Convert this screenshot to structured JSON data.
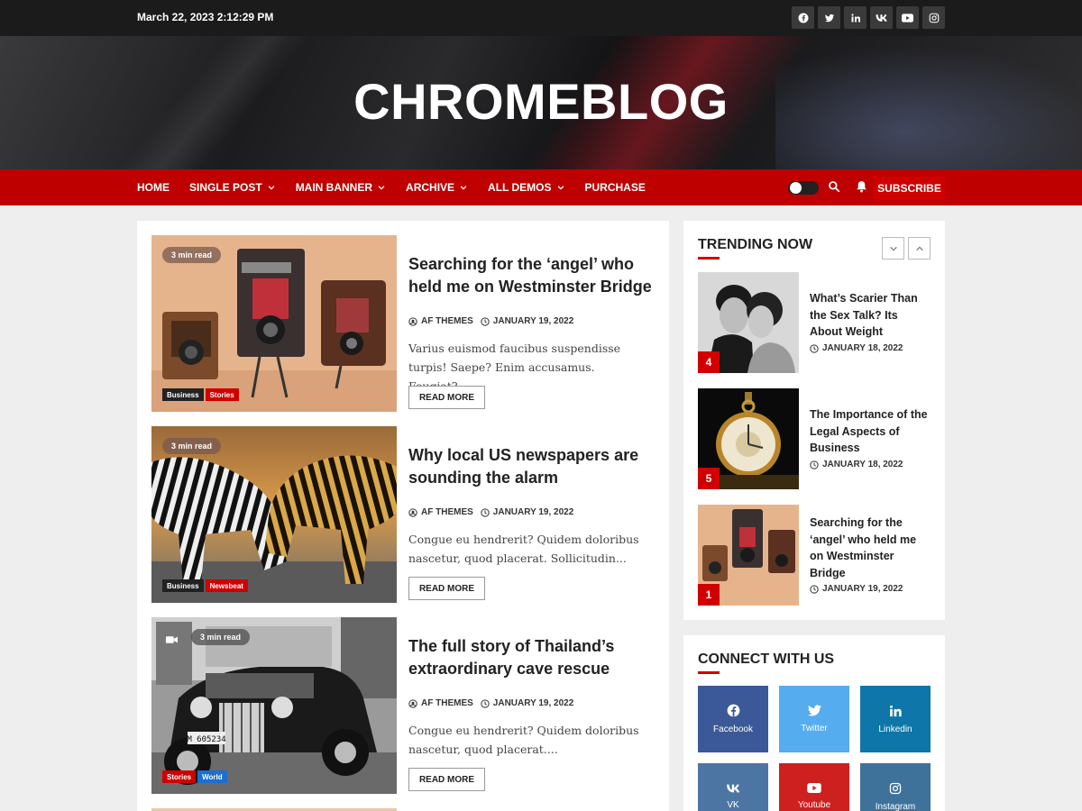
{
  "topbar": {
    "datetime": "March 22, 2023 2:12:29 PM",
    "socials": [
      "facebook-icon",
      "twitter-icon",
      "linkedin-icon",
      "vk-icon",
      "youtube-icon",
      "instagram-icon"
    ]
  },
  "site": {
    "title": "CHROMEBLOG"
  },
  "nav": {
    "items": [
      {
        "label": "HOME",
        "dropdown": false
      },
      {
        "label": "SINGLE POST",
        "dropdown": true
      },
      {
        "label": "MAIN BANNER",
        "dropdown": true
      },
      {
        "label": "ARCHIVE",
        "dropdown": true
      },
      {
        "label": "ALL DEMOS",
        "dropdown": true
      },
      {
        "label": "PURCHASE",
        "dropdown": false
      }
    ],
    "subscribe_label": "SUBSCRIBE"
  },
  "posts": [
    {
      "read_time": "3 min read",
      "title": "Searching for the ‘angel’ who held me on Westminster Bridge",
      "author": "AF THEMES",
      "date": "JANUARY 19, 2022",
      "excerpt": "Varius euismod faucibus suspendisse turpis! Saepe? Enim accusamus. Feugiat?...",
      "read_more": "READ MORE",
      "tags": [
        {
          "label": "Business",
          "color": "#222222"
        },
        {
          "label": "Stories",
          "color": "#d10000"
        }
      ]
    },
    {
      "read_time": "3 min read",
      "title": "Why local US newspapers are sounding the alarm",
      "author": "AF THEMES",
      "date": "JANUARY 19, 2022",
      "excerpt": "Congue eu hendrerit? Quidem doloribus nascetur, quod placerat. Sollicitudin...",
      "read_more": "READ MORE",
      "tags": [
        {
          "label": "Business",
          "color": "#222222"
        },
        {
          "label": "Newsbeat",
          "color": "#d10000"
        }
      ]
    },
    {
      "read_time": "3 min read",
      "title": "The full story of Thailand’s extraordinary cave rescue",
      "author": "AF THEMES",
      "date": "JANUARY 19, 2022",
      "excerpt": "Congue eu hendrerit? Quidem doloribus nascetur, quod placerat....",
      "read_more": "READ MORE",
      "plate": "M 605234",
      "tags": [
        {
          "label": "Stories",
          "color": "#d10000"
        },
        {
          "label": "World",
          "color": "#1a6fd1"
        }
      ]
    }
  ],
  "trending": {
    "heading": "TRENDING NOW",
    "items": [
      {
        "rank": "4",
        "title": "What’s Scarier Than the Sex Talk? Its About Weight",
        "date": "JANUARY 18, 2022"
      },
      {
        "rank": "5",
        "title": "The Importance of the Legal Aspects of Business",
        "date": "JANUARY 18, 2022"
      },
      {
        "rank": "1",
        "title": "Searching for the ‘angel’ who held me on Westminster Bridge",
        "date": "JANUARY 19, 2022"
      }
    ]
  },
  "connect": {
    "heading": "CONNECT WITH US",
    "tiles": [
      {
        "label": "Facebook",
        "icon": "facebook-icon",
        "color": "#3b5998"
      },
      {
        "label": "Twitter",
        "icon": "twitter-icon",
        "color": "#55acee"
      },
      {
        "label": "Linkedin",
        "icon": "linkedin-icon",
        "color": "#0e76a8"
      },
      {
        "label": "VK",
        "icon": "vk-icon",
        "color": "#4c75a3"
      },
      {
        "label": "Youtube",
        "icon": "youtube-icon",
        "color": "#cd201f"
      },
      {
        "label": "Instagram",
        "icon": "instagram-icon",
        "color": "#3f729b"
      }
    ]
  },
  "colors": {
    "accent": "#be0000",
    "topbar": "#1b1b1b",
    "page_bg": "#eeeeee"
  }
}
